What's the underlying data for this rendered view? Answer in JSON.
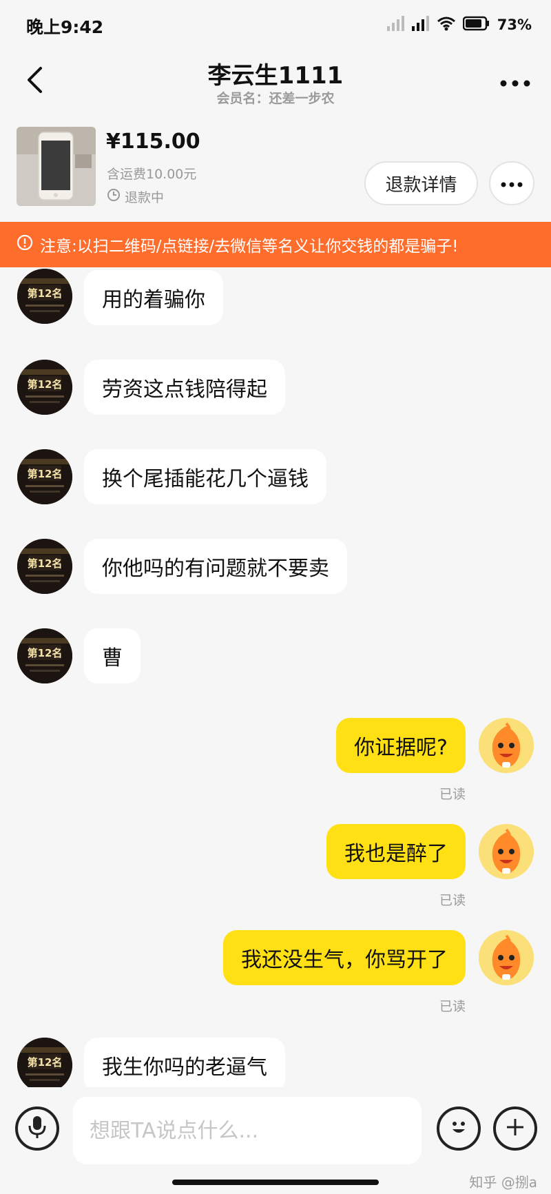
{
  "status_bar": {
    "time": "晚上9:42",
    "battery": "73%",
    "icons": [
      "signal-icon",
      "signal-icon",
      "wifi-icon",
      "battery-icon"
    ]
  },
  "header": {
    "title": "李云生1111",
    "subtitle": "会员名：还差一步农"
  },
  "order": {
    "price": "¥115.00",
    "shipping": "含运费10.00元",
    "status": "退款中",
    "refund_button": "退款详情"
  },
  "warning": "注意:以扫二维码/点链接/去微信等名义让你交钱的都是骗子!",
  "messages": [
    {
      "side": "left",
      "text": "用的着骗你"
    },
    {
      "side": "left",
      "text": "劳资这点钱陪得起"
    },
    {
      "side": "left",
      "text": "换个尾插能花几个逼钱"
    },
    {
      "side": "left",
      "text": "你他吗的有问题就不要卖"
    },
    {
      "side": "left",
      "text": "曹"
    },
    {
      "side": "right",
      "text": "你证据呢?",
      "status": "已读"
    },
    {
      "side": "right",
      "text": "我也是醉了",
      "status": "已读"
    },
    {
      "side": "right",
      "text": "我还没生气，你骂开了",
      "status": "已读"
    },
    {
      "side": "left",
      "text": "我生你吗的老逼气"
    }
  ],
  "input": {
    "placeholder": "想跟TA说点什么..."
  },
  "avatar_badge": "第12名",
  "watermark": "知乎 @捌a",
  "colors": {
    "accent": "#ffe014",
    "warning": "#ff6d2d",
    "background": "#f6f6f6"
  }
}
